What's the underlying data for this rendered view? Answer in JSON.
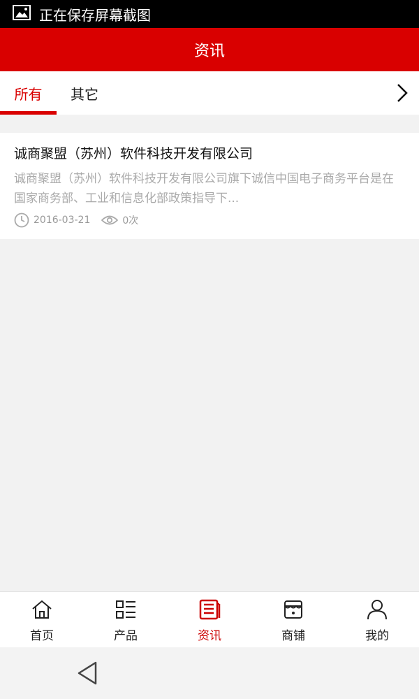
{
  "status_bar": {
    "text": "正在保存屏幕截图"
  },
  "header": {
    "title": "资讯"
  },
  "tabs": [
    {
      "label": "所有",
      "active": true
    },
    {
      "label": "其它",
      "active": false
    }
  ],
  "news": [
    {
      "title": "诚商聚盟（苏州）软件科技开发有限公司",
      "description": "诚商聚盟（苏州）软件科技开发有限公司旗下诚信中国电子商务平台是在国家商务部、工业和信息化部政策指导下...",
      "date": "2016-03-21",
      "views": "0次"
    }
  ],
  "bottom_nav": [
    {
      "label": "首页",
      "icon": "home-icon"
    },
    {
      "label": "产品",
      "icon": "grid-list-icon"
    },
    {
      "label": "资讯",
      "icon": "news-icon",
      "active": true
    },
    {
      "label": "商铺",
      "icon": "store-icon"
    },
    {
      "label": "我的",
      "icon": "user-icon"
    }
  ],
  "colors": {
    "accent": "#d90000",
    "inactive_text": "#222222",
    "muted_text": "#aaaaaa"
  }
}
